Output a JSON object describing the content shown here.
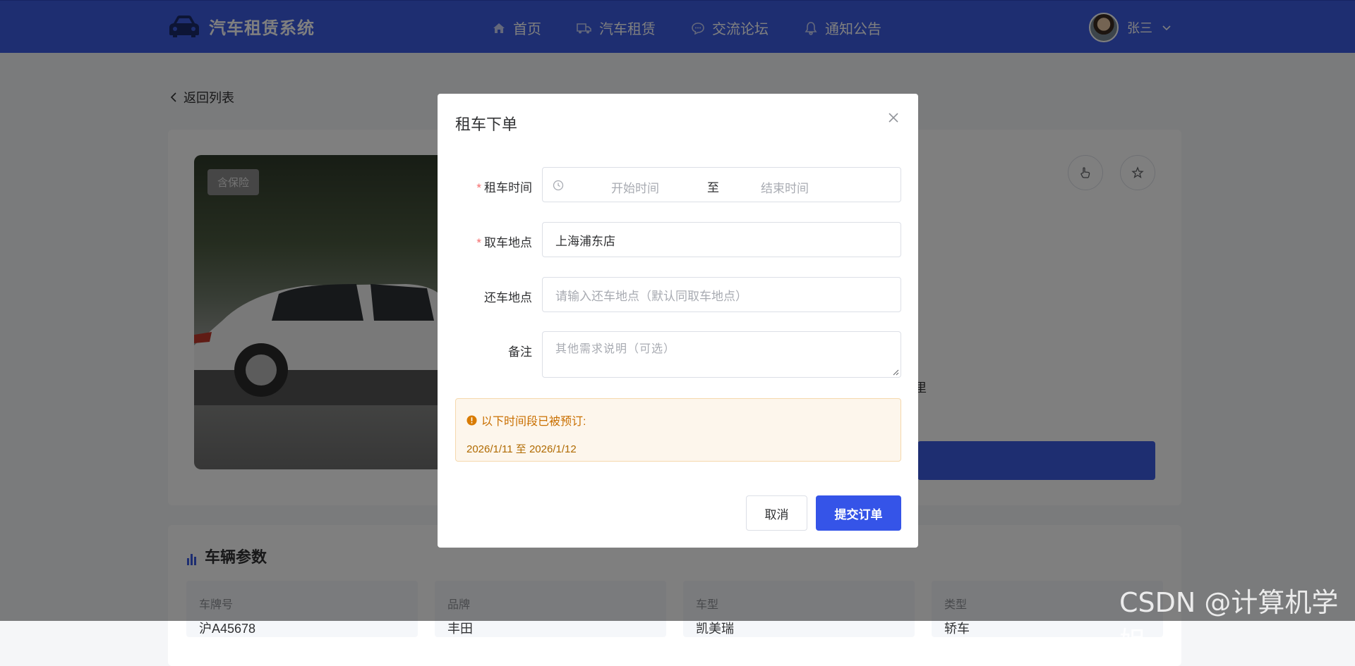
{
  "header": {
    "app_title": "汽车租赁系统",
    "nav": [
      {
        "label": "首页",
        "icon": "home-icon"
      },
      {
        "label": "汽车租赁",
        "icon": "truck-icon"
      },
      {
        "label": "交流论坛",
        "icon": "chat-icon"
      },
      {
        "label": "通知公告",
        "icon": "bell-icon"
      }
    ],
    "user_name": "张三"
  },
  "page": {
    "back_label": "返回列表",
    "insurance_badge": "含保险",
    "partial_text": "里",
    "params_title": "车辆参数",
    "params": [
      {
        "label": "车牌号",
        "value": "沪A45678"
      },
      {
        "label": "品牌",
        "value": "丰田"
      },
      {
        "label": "车型",
        "value": "凯美瑞"
      },
      {
        "label": "类型",
        "value": "轿车"
      }
    ]
  },
  "modal": {
    "title": "租车下单",
    "fields": {
      "rent_time_label": "租车时间",
      "start_placeholder": "开始时间",
      "range_separator": "至",
      "end_placeholder": "结束时间",
      "pickup_label": "取车地点",
      "pickup_value": "上海浦东店",
      "return_label": "还车地点",
      "return_placeholder": "请输入还车地点（默认同取车地点）",
      "remark_label": "备注",
      "remark_placeholder": "其他需求说明（可选）"
    },
    "alert": {
      "title": "以下时间段已被预订:",
      "booked_range": "2026/1/11 至 2026/1/12"
    },
    "cancel_label": "取消",
    "submit_label": "提交订单"
  },
  "watermark": "CSDN @计算机学姐",
  "colors": {
    "primary": "#3d5ce3",
    "submit": "#3554e8",
    "required": "#f56c6c",
    "warning_bg": "#fdf6ec",
    "warning_text": "#c96f00"
  }
}
